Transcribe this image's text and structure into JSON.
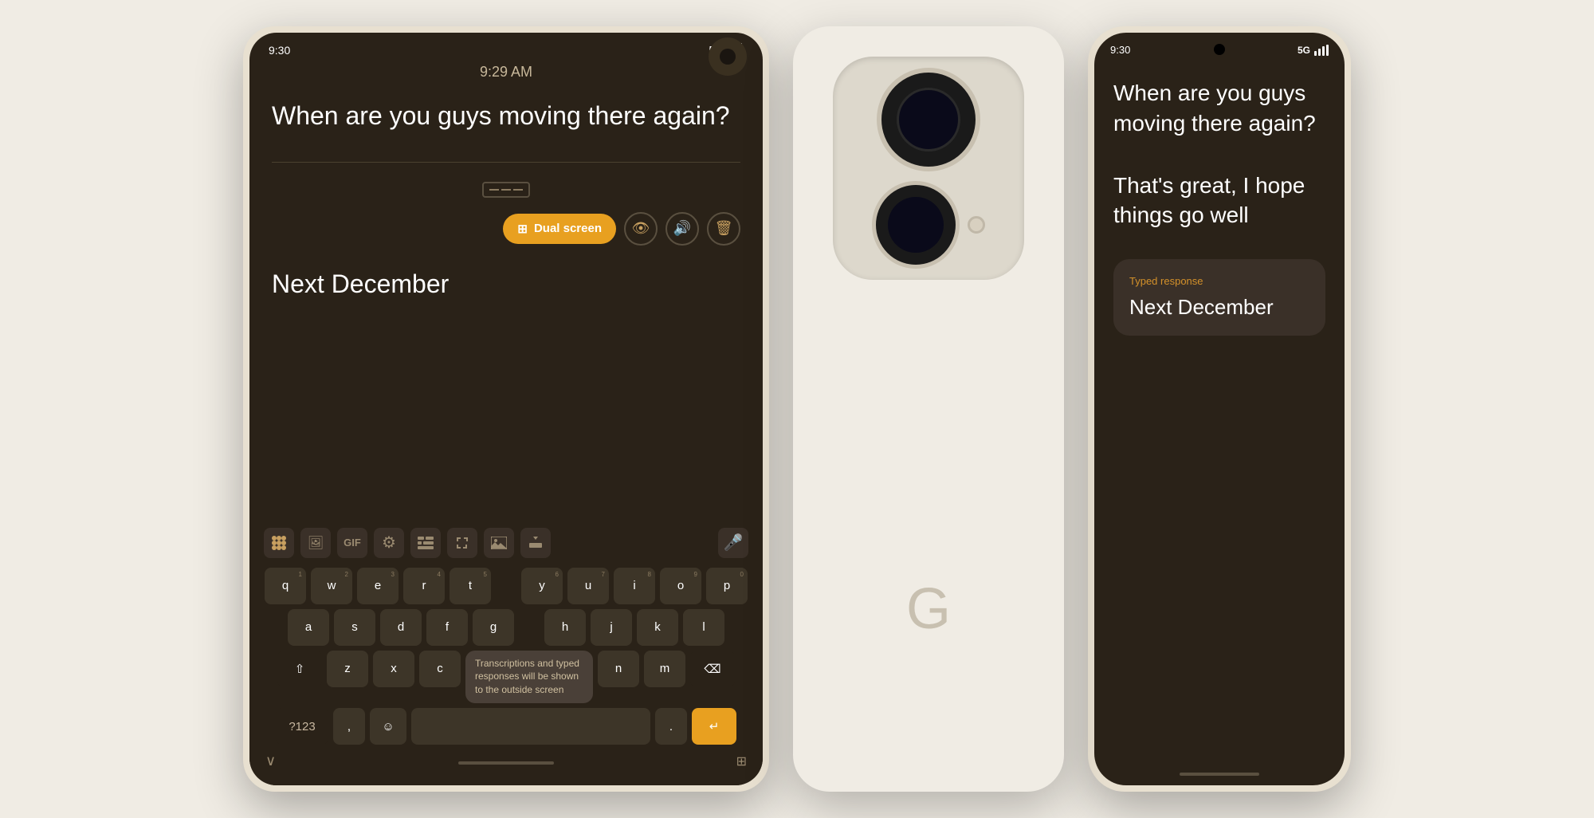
{
  "scene": {
    "background_color": "#f0ece4"
  },
  "foldable": {
    "status_bar": {
      "time": "9:30",
      "network": "5G",
      "signal": "▲"
    },
    "center_time": "9:29 AM",
    "transcription": "When are you guys moving there again?",
    "typed_response": "Next December",
    "toolbar": {
      "dual_screen_label": "Dual screen",
      "eye_icon": "👁",
      "speaker_icon": "🔊",
      "delete_icon": "🗑"
    },
    "keyboard": {
      "tooltip": "Transcriptions and typed responses will be shown to the outside screen",
      "rows": [
        [
          "q",
          "w",
          "e",
          "r",
          "t",
          "y",
          "u",
          "i",
          "o",
          "p"
        ],
        [
          "a",
          "s",
          "d",
          "f",
          "g",
          "h",
          "j",
          "k",
          "l"
        ],
        [
          "z",
          "x",
          "c",
          "n",
          "m"
        ]
      ],
      "numbers": [
        "1",
        "2",
        "3",
        "4",
        "5",
        "6",
        "7",
        "8",
        "9",
        "0"
      ],
      "special_keys": {
        "shift": "⇧",
        "backspace": "⌫",
        "enter": "↵",
        "special_chars": "?123",
        "comma": ",",
        "emoji": "☺",
        "period": ".",
        "grid": "⊞"
      }
    }
  },
  "phone_back": {
    "logo": "G"
  },
  "phone_front": {
    "status_bar": {
      "time": "9:30",
      "network": "5G",
      "signal": "▲"
    },
    "conversation": {
      "question": "When are you guys moving there again?",
      "response": "That's great, I hope things go well"
    },
    "typed_response_card": {
      "label": "Typed response",
      "value": "Next December"
    }
  }
}
